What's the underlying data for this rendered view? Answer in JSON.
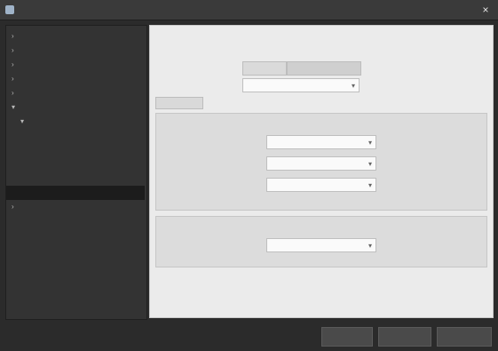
{
  "window": {
    "title": "",
    "close_glyph": "×"
  },
  "sidebar": {
    "items": [
      {
        "label": "",
        "caret": "›"
      },
      {
        "label": "",
        "caret": "›"
      },
      {
        "label": "",
        "caret": "›"
      },
      {
        "label": "",
        "caret": "›"
      },
      {
        "label": "",
        "caret": "›"
      },
      {
        "label": "",
        "caret": "▾"
      },
      {
        "label": "",
        "caret": "▾"
      },
      {
        "label": "",
        "caret": ""
      },
      {
        "label": "",
        "caret": ""
      },
      {
        "label": "",
        "caret": ""
      },
      {
        "label": "",
        "caret": ""
      },
      {
        "label": "",
        "caret": ""
      },
      {
        "label": "",
        "caret": "›"
      }
    ]
  },
  "main": {
    "page_title": "",
    "section_label": "",
    "row1": {
      "label": "",
      "seg_left": "",
      "seg_right": ""
    },
    "row2": {
      "label": "",
      "value": ""
    },
    "tabs": [
      {
        "label": ""
      },
      {
        "label": ""
      }
    ],
    "group1": {
      "title": "",
      "fields": [
        {
          "label": "",
          "value": ""
        },
        {
          "label": "",
          "value": ""
        },
        {
          "label": "",
          "value": ""
        }
      ]
    },
    "group2": {
      "title": "",
      "fields": [
        {
          "label": "",
          "value": ""
        }
      ]
    }
  },
  "footer": {
    "buttons": [
      {
        "label": ""
      },
      {
        "label": ""
      },
      {
        "label": ""
      }
    ]
  }
}
